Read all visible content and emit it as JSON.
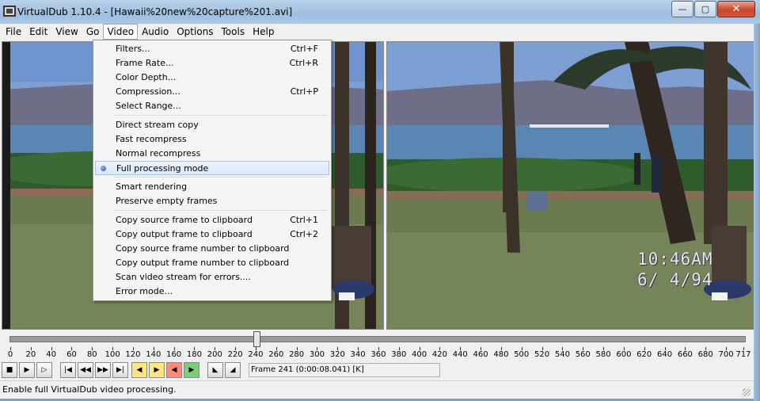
{
  "window": {
    "title": "VirtualDub 1.10.4 - [Hawaii%20new%20capture%201.avi]",
    "buttons": {
      "minimize": "—",
      "maximize": "▢",
      "close": "✕"
    }
  },
  "menubar": [
    "File",
    "Edit",
    "View",
    "Go",
    "Video",
    "Audio",
    "Options",
    "Tools",
    "Help"
  ],
  "video_menu": {
    "groups": [
      [
        {
          "label": "Filters...",
          "shortcut": "Ctrl+F"
        },
        {
          "label": "Frame Rate...",
          "shortcut": "Ctrl+R"
        },
        {
          "label": "Color Depth...",
          "shortcut": ""
        },
        {
          "label": "Compression...",
          "shortcut": "Ctrl+P"
        },
        {
          "label": "Select Range...",
          "shortcut": ""
        }
      ],
      [
        {
          "label": "Direct stream copy",
          "shortcut": ""
        },
        {
          "label": "Fast recompress",
          "shortcut": ""
        },
        {
          "label": "Normal recompress",
          "shortcut": ""
        },
        {
          "label": "Full processing mode",
          "shortcut": "",
          "checked": true
        }
      ],
      [
        {
          "label": "Smart rendering",
          "shortcut": ""
        },
        {
          "label": "Preserve empty frames",
          "shortcut": ""
        }
      ],
      [
        {
          "label": "Copy source frame to clipboard",
          "shortcut": "Ctrl+1"
        },
        {
          "label": "Copy output frame to clipboard",
          "shortcut": "Ctrl+2"
        },
        {
          "label": "Copy source frame number to clipboard",
          "shortcut": ""
        },
        {
          "label": "Copy output frame number to clipboard",
          "shortcut": ""
        },
        {
          "label": "Scan video stream for errors....",
          "shortcut": ""
        },
        {
          "label": "Error mode...",
          "shortcut": ""
        }
      ]
    ]
  },
  "output_overlay": {
    "time": "10:46AM",
    "date": "6/ 4/94"
  },
  "timeline": {
    "ticks": [
      "0",
      "20",
      "40",
      "60",
      "80",
      "100",
      "120",
      "140",
      "160",
      "180",
      "200",
      "220",
      "240",
      "260",
      "280",
      "300",
      "320",
      "340",
      "360",
      "380",
      "400",
      "420",
      "440",
      "460",
      "480",
      "500",
      "520",
      "540",
      "560",
      "580",
      "600",
      "620",
      "640",
      "660",
      "680",
      "700",
      "717"
    ],
    "current_frame": 241,
    "total_frames": 717
  },
  "frame_info": "Frame 241 (0:00:08.041) [K]",
  "status": "Enable full VirtualDub video processing.",
  "colors": {
    "accent": "#3399ff",
    "titlebar": "#a9c6e6"
  }
}
